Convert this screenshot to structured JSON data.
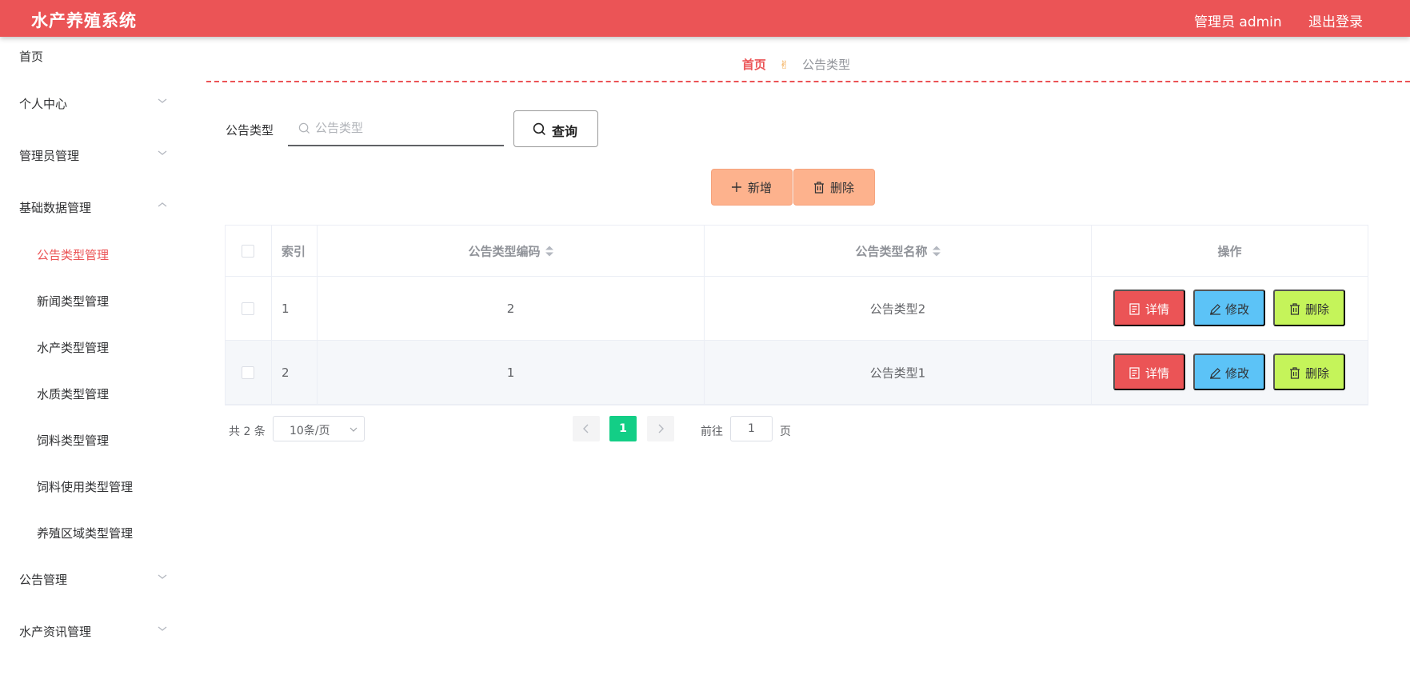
{
  "app": {
    "title": "水产养殖系统",
    "user_label": "管理员 admin",
    "logout_label": "退出登录",
    "accent_color": "#eb5456"
  },
  "sidebar": {
    "items": [
      {
        "label": "首页"
      },
      {
        "label": "个人中心",
        "expandable": true
      },
      {
        "label": "管理员管理",
        "expandable": true
      },
      {
        "label": "基础数据管理",
        "expandable": true,
        "expanded": true
      },
      {
        "label": "公告类型管理",
        "sub": true,
        "active": true
      },
      {
        "label": "新闻类型管理",
        "sub": true
      },
      {
        "label": "水产类型管理",
        "sub": true
      },
      {
        "label": "水质类型管理",
        "sub": true
      },
      {
        "label": "饲料类型管理",
        "sub": true
      },
      {
        "label": "饲料使用类型管理",
        "sub": true
      },
      {
        "label": "养殖区域类型管理",
        "sub": true
      },
      {
        "label": "公告管理",
        "expandable": true
      },
      {
        "label": "水产资讯管理",
        "expandable": true
      }
    ]
  },
  "breadcrumb": {
    "home": "首页",
    "current": "公告类型"
  },
  "search": {
    "label": "公告类型",
    "placeholder": "公告类型",
    "value": "",
    "button_label": "查询"
  },
  "toolbar": {
    "add_label": "新增",
    "delete_label": "删除"
  },
  "table": {
    "columns": [
      "索引",
      "公告类型编码",
      "公告类型名称",
      "操作"
    ],
    "rows": [
      {
        "index": "1",
        "code": "2",
        "name": "公告类型2"
      },
      {
        "index": "2",
        "code": "1",
        "name": "公告类型1"
      }
    ],
    "actions": {
      "detail": "详情",
      "edit": "修改",
      "delete": "删除"
    }
  },
  "pagination": {
    "total_text": "共 2 条",
    "page_size": "10条/页",
    "current_page": "1",
    "goto_label": "前往",
    "goto_value": "1",
    "page_suffix": "页"
  }
}
